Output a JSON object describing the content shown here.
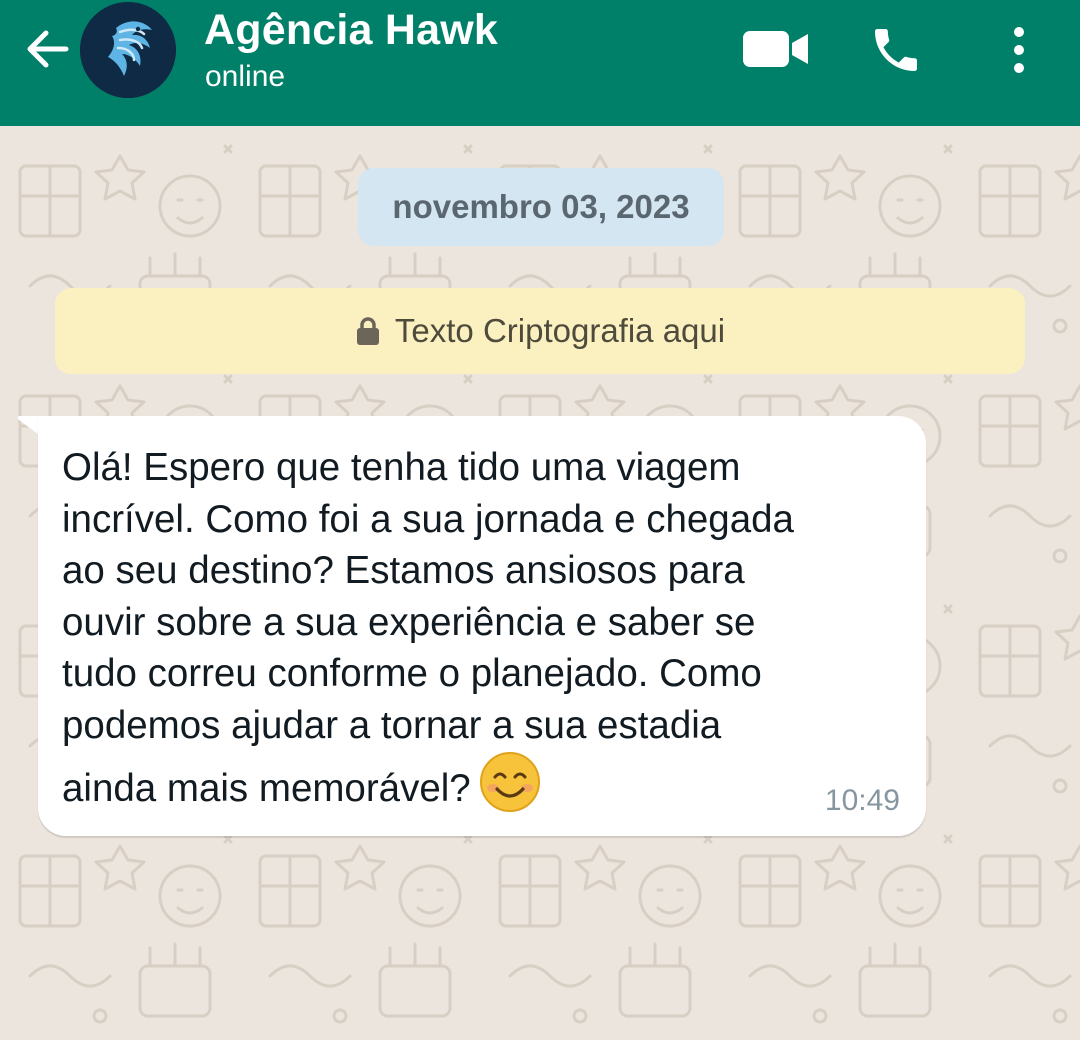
{
  "header": {
    "back_icon": "arrow-left-icon",
    "avatar_icon": "hawk-logo",
    "contact_name": "Agência Hawk",
    "status": "online",
    "video_icon": "video-camera-icon",
    "call_icon": "phone-icon",
    "menu_icon": "more-vertical-icon"
  },
  "chat": {
    "date_label": "novembro 03, 2023",
    "system_notice": {
      "icon": "lock-icon",
      "text": "Texto Criptografia aqui"
    },
    "messages": [
      {
        "direction": "incoming",
        "text": "Olá! Espero que tenha tido uma viagem\nincrível. Como foi a sua jornada e chegada\nao seu destino? Estamos ansiosos para\nouvir sobre a sua experiência e saber se\ntudo correu conforme o planejado. Como\npodemos ajudar a tornar a sua estadia\nainda mais memorável?",
        "emoji": "smiling-face-icon",
        "time": "10:49"
      }
    ]
  },
  "colors": {
    "header": "#008069",
    "chat_background": "#ece5dd",
    "date_chip": "#d3e6f2",
    "notice_background": "#fbf1c0",
    "bubble": "#ffffff",
    "timestamp": "#8696a0"
  }
}
